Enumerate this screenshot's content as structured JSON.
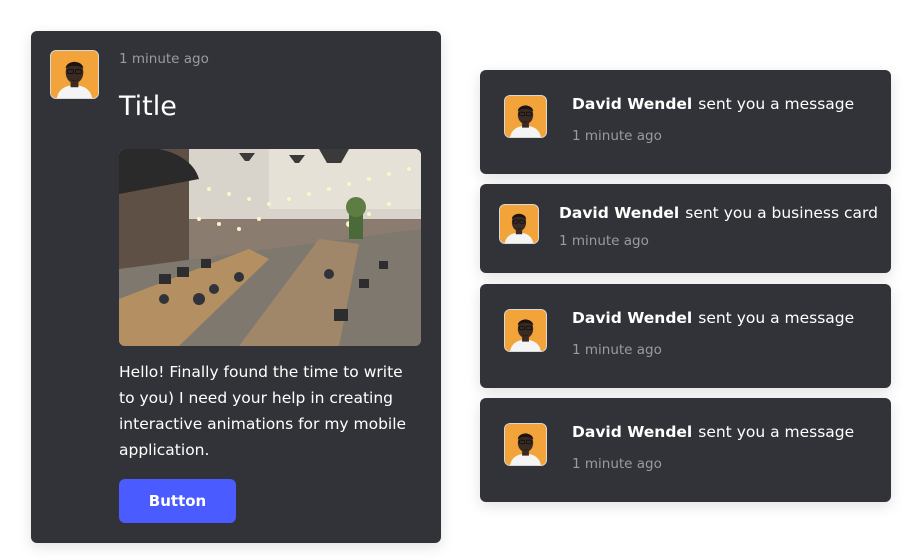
{
  "post": {
    "time": "1 minute ago",
    "title": "Title",
    "body": "Hello! Finally found the time to write to you) I need your help in creating interactive animations for my mobile application.",
    "button_label": "Button",
    "image_icon": "office-photo",
    "avatar_icon": "user-avatar"
  },
  "notifications": [
    {
      "name": "David Wendel",
      "action": "sent you a message",
      "time": "1 minute ago"
    },
    {
      "name": "David Wendel",
      "action": "sent you a business card",
      "time": "1 minute ago"
    },
    {
      "name": "David Wendel",
      "action": "sent you a message",
      "time": "1 minute ago"
    },
    {
      "name": "David Wendel",
      "action": "sent you a message",
      "time": "1 minute ago"
    }
  ],
  "colors": {
    "card_background": "#323338",
    "button_accent": "#4a5cff",
    "avatar_background": "#f0a23a",
    "muted_text": "#9a9ba1"
  }
}
